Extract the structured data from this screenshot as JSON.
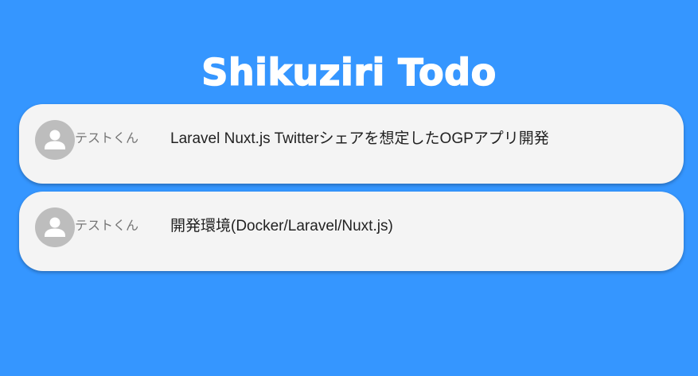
{
  "app": {
    "title": "Shikuziri Todo"
  },
  "colors": {
    "background": "#3596FF",
    "card": "#F4F4F4",
    "avatar": "#BDBDBD"
  },
  "todos": [
    {
      "avatar_icon": "person-icon",
      "user": "テストくん",
      "text": "Laravel Nuxt.js Twitterシェアを想定したOGPアプリ開発"
    },
    {
      "avatar_icon": "person-icon",
      "user": "テストくん",
      "text": "開発環境(Docker/Laravel/Nuxt.js)"
    }
  ]
}
